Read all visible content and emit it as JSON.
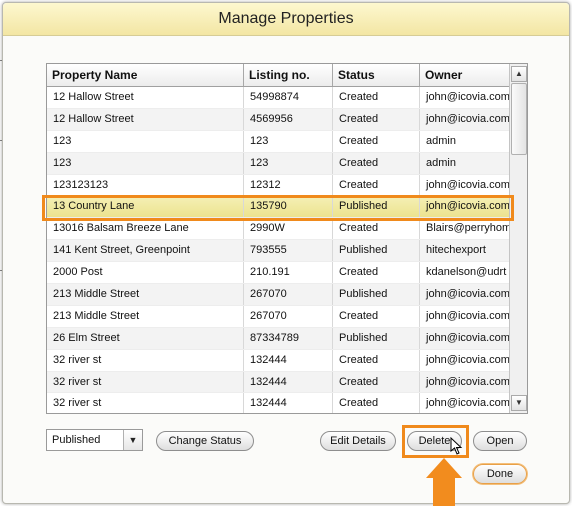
{
  "dialog": {
    "title": "Manage Properties"
  },
  "table": {
    "columns": [
      "Property Name",
      "Listing no.",
      "Status",
      "Owner"
    ],
    "rows": [
      [
        "12 Hallow Street",
        "54998874",
        "Created",
        "john@icovia.com"
      ],
      [
        "12 Hallow Street",
        "4569956",
        "Created",
        "john@icovia.com"
      ],
      [
        "123",
        "123",
        "Created",
        "admin"
      ],
      [
        "123",
        "123",
        "Created",
        "admin"
      ],
      [
        "123123123",
        "12312",
        "Created",
        "john@icovia.com"
      ],
      [
        "13 Country Lane",
        "135790",
        "Published",
        "john@icovia.com"
      ],
      [
        "13016 Balsam Breeze Lane",
        "2990W",
        "Created",
        "Blairs@perryhomes"
      ],
      [
        "141 Kent Street, Greenpoint",
        "793555",
        "Published",
        "hitechexport"
      ],
      [
        "2000 Post",
        "210.191",
        "Created",
        "kdanelson@udrt"
      ],
      [
        "213 Middle Street",
        "267070",
        "Published",
        "john@icovia.com"
      ],
      [
        "213 Middle Street",
        "267070",
        "Created",
        "john@icovia.com"
      ],
      [
        "26 Elm Street",
        "87334789",
        "Published",
        "john@icovia.com"
      ],
      [
        "32 river st",
        "132444",
        "Created",
        "john@icovia.com"
      ],
      [
        "32 river st",
        "132444",
        "Created",
        "john@icovia.com"
      ],
      [
        "32 river st",
        "132444",
        "Created",
        "john@icovia.com"
      ]
    ],
    "selected_row": 5
  },
  "status_select": {
    "value": "Published"
  },
  "buttons": {
    "change_status": "Change Status",
    "edit_details": "Edit Details",
    "delete": "Delete",
    "open": "Open",
    "done": "Done"
  },
  "icons": {
    "scroll_up": "triangle-up-icon",
    "scroll_down": "triangle-down-icon",
    "dropdown": "triangle-down-icon",
    "cursor": "pointer-cursor-icon"
  },
  "colors": {
    "title_bar": "#f3e6a4",
    "selected_row": "#ece38f",
    "annotation": "#f08a1c"
  }
}
